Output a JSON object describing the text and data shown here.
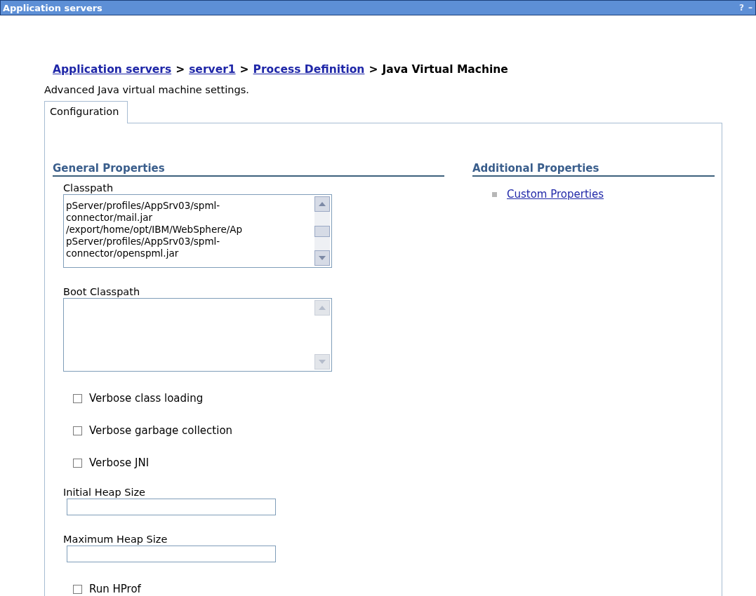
{
  "window": {
    "title": "Application servers",
    "help": "?",
    "minimize": "–"
  },
  "breadcrumb": {
    "separator": ">",
    "items": [
      {
        "label": "Application servers",
        "link": true
      },
      {
        "label": "server1",
        "link": true
      },
      {
        "label": "Process Definition",
        "link": true
      },
      {
        "label": "Java Virtual Machine",
        "link": false
      }
    ]
  },
  "description": "Advanced Java virtual machine settings.",
  "tabs": [
    {
      "label": "Configuration",
      "selected": true
    }
  ],
  "general_properties": {
    "title": "General Properties",
    "fields": [
      {
        "kind": "textarea",
        "label": "Classpath",
        "lines": [
          "pServer/profiles/AppSrv03/spml-",
          "connector/mail.jar",
          "/export/home/opt/IBM/WebSphere/Ap",
          "pServer/profiles/AppSrv03/spml-",
          "connector/openspml.jar"
        ]
      },
      {
        "kind": "textarea",
        "label": "Boot Classpath"
      },
      {
        "kind": "checkbox",
        "label": "Verbose class loading",
        "checked": false
      },
      {
        "kind": "checkbox",
        "label": "Verbose garbage collection",
        "checked": false
      },
      {
        "kind": "checkbox",
        "label": "Verbose JNI",
        "checked": false
      },
      {
        "kind": "text",
        "label": "Initial Heap Size"
      },
      {
        "kind": "text",
        "label": "Maximum Heap Size"
      },
      {
        "kind": "checkbox",
        "label": "Run HProf",
        "checked": false
      }
    ]
  },
  "additional_properties": {
    "title": "Additional Properties",
    "links": [
      "Custom Properties"
    ]
  }
}
